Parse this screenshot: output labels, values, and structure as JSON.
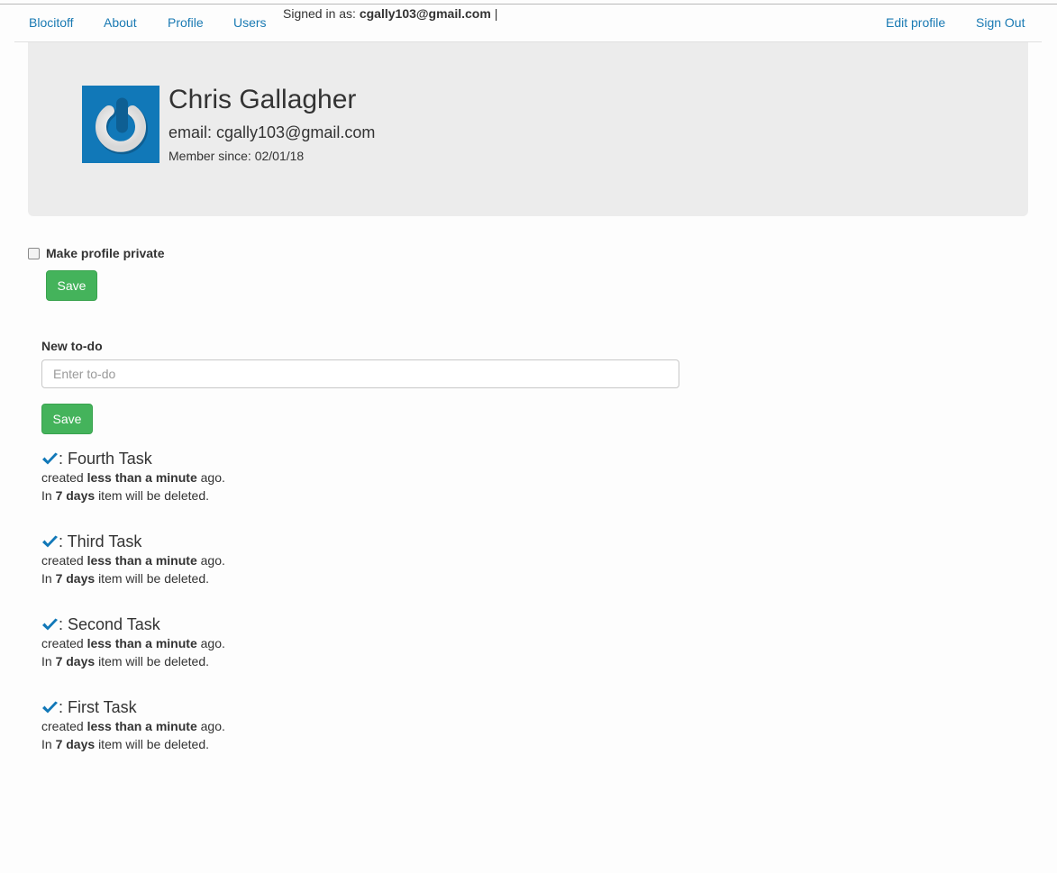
{
  "nav": {
    "links": [
      "Blocitoff",
      "About",
      "Profile",
      "Users"
    ],
    "signed_in_prefix": "Signed in as:",
    "signed_in_email": "cgally103@gmail.com",
    "signed_in_sep": "|",
    "edit_profile": "Edit profile",
    "sign_out": "Sign Out"
  },
  "profile": {
    "name": "Chris Gallagher",
    "email": "email: cgally103@gmail.com",
    "member_since": "Member since: 02/01/18",
    "avatar_icon": "power-icon",
    "avatar_color": "#1178b8"
  },
  "privacy": {
    "label": "Make profile private",
    "checked": false,
    "save_label": "Save"
  },
  "todo_form": {
    "label": "New to-do",
    "placeholder": "Enter to-do",
    "value": "",
    "save_label": "Save"
  },
  "tasks": [
    {
      "name": ": Fourth Task",
      "created_prefix": "created",
      "created_age": "less than a minute",
      "created_suffix": "ago.",
      "delete_prefix": "In",
      "delete_days": "7 days",
      "delete_suffix": "item will be deleted."
    },
    {
      "name": ": Third Task",
      "created_prefix": "created",
      "created_age": "less than a minute",
      "created_suffix": "ago.",
      "delete_prefix": "In",
      "delete_days": "7 days",
      "delete_suffix": "item will be deleted."
    },
    {
      "name": ": Second Task",
      "created_prefix": "created",
      "created_age": "less than a minute",
      "created_suffix": "ago.",
      "delete_prefix": "In",
      "delete_days": "7 days",
      "delete_suffix": "item will be deleted."
    },
    {
      "name": ": First Task",
      "created_prefix": "created",
      "created_age": "less than a minute",
      "created_suffix": "ago.",
      "delete_prefix": "In",
      "delete_days": "7 days",
      "delete_suffix": "item will be deleted."
    }
  ],
  "colors": {
    "link": "#1a7ab3",
    "success": "#44b35b",
    "check": "#1178b8",
    "jumbotron": "#ececec"
  }
}
